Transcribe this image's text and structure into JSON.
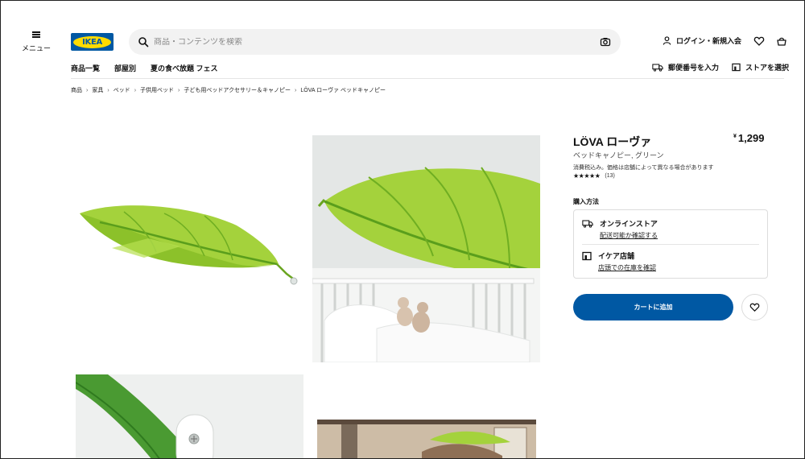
{
  "header": {
    "menu_label": "メニュー",
    "logo_text": "IKEA",
    "search_placeholder": "商品・コンテンツを検索",
    "login_label": "ログイン・新規入会"
  },
  "nav": {
    "items": [
      "商品一覧",
      "部屋別",
      "夏の食べ放題 フェス"
    ],
    "postal_label": "郵便番号を入力",
    "store_label": "ストアを選択"
  },
  "breadcrumb": [
    "商品",
    "家具",
    "ベッド",
    "子供用ベッド",
    "子ども用ベッドアクセサリー＆キャノピー",
    "LÖVA ローヴァ ベッドキャノピー"
  ],
  "product": {
    "name": "LÖVA ローヴァ",
    "currency": "¥",
    "price": "1,299",
    "subtitle": "ベッドキャノピー, グリーン",
    "tax_note": "消費税込み。価格は店舗によって異なる場合があります",
    "stars": "★★★★★",
    "rating_value": 4.5,
    "review_count": "(13)"
  },
  "purchase": {
    "title": "購入方法",
    "online_title": "オンラインストア",
    "online_link": "配送可能か確認する",
    "store_title": "イケア店舗",
    "store_link": "店頭での在庫を確認",
    "cart_button": "カートに追加"
  },
  "colors": {
    "ikea_blue": "#0058a3",
    "ikea_yellow": "#ffdb00",
    "leaf_green": "#9fd13b"
  }
}
